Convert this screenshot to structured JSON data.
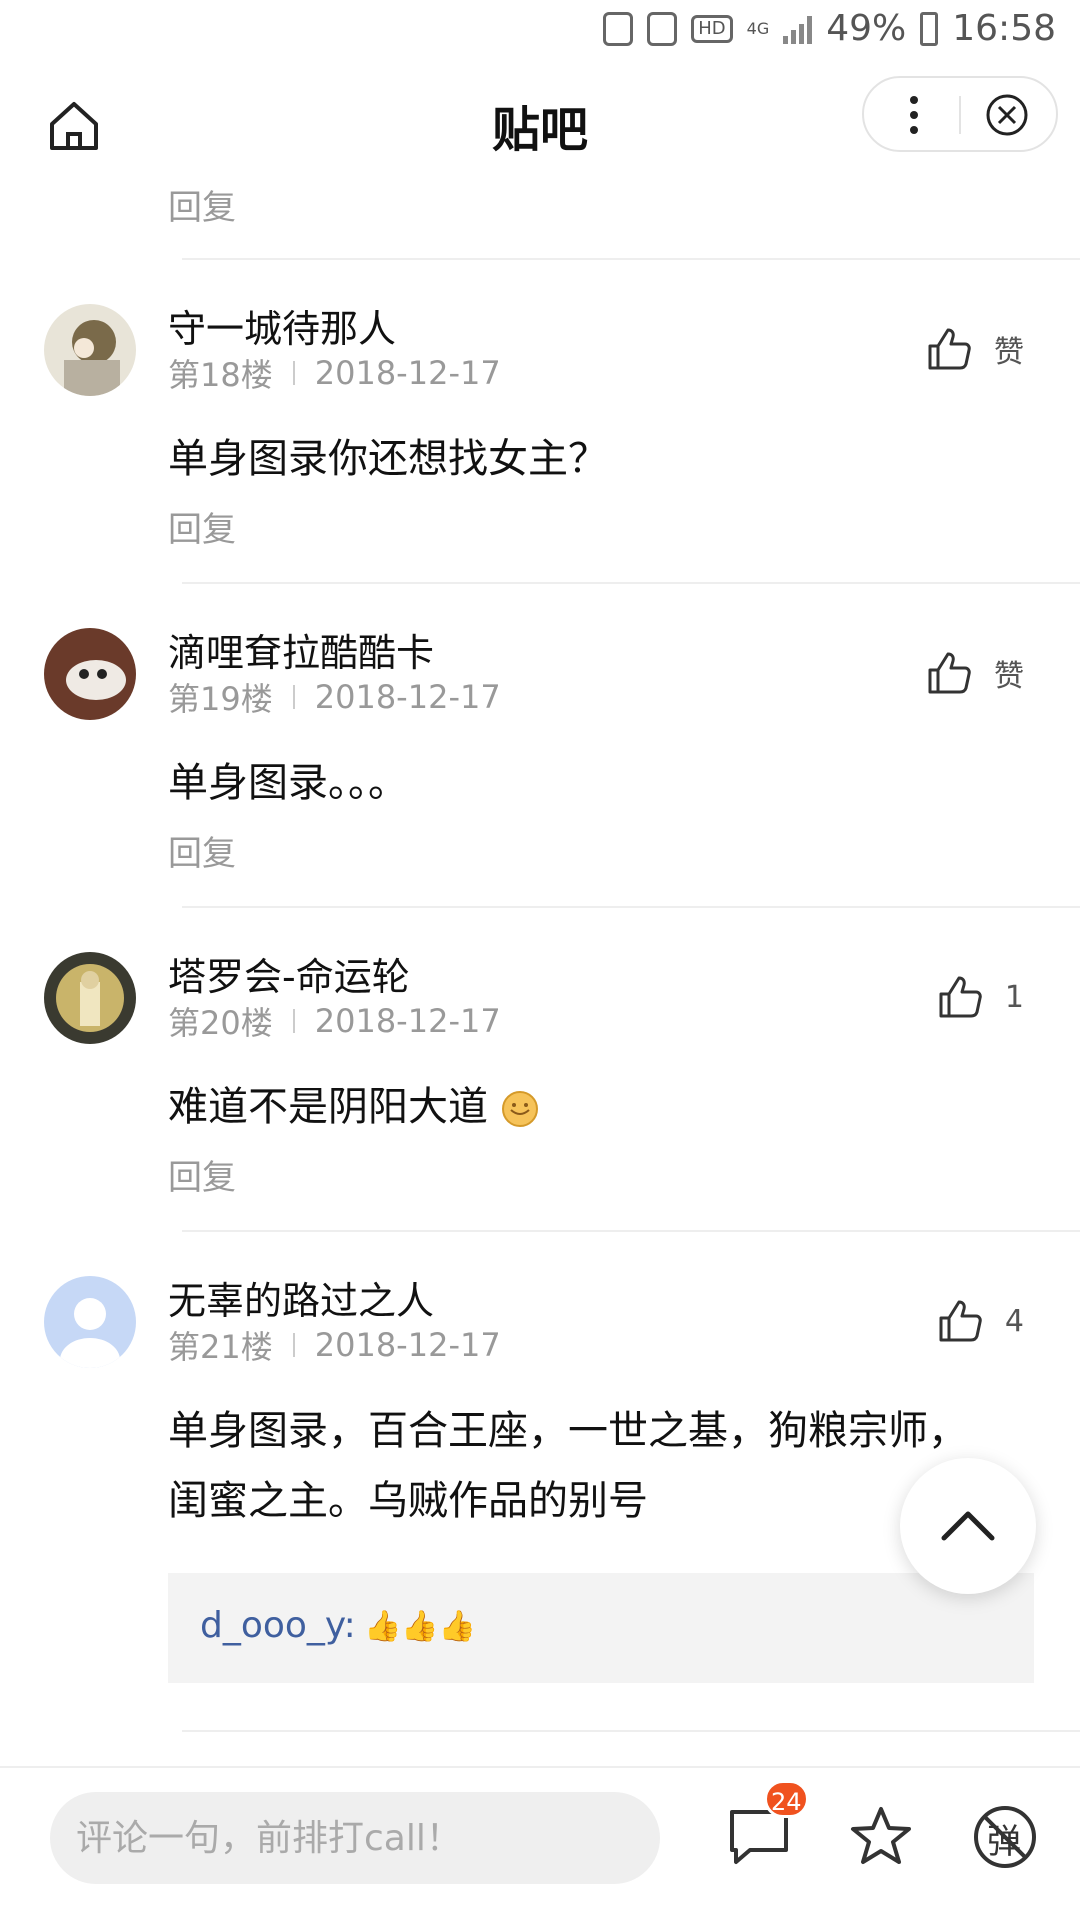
{
  "status_bar": {
    "battery_percent": "49%",
    "time": "16:58",
    "network": "4G",
    "hd": "HD"
  },
  "header": {
    "title": "贴吧"
  },
  "previous_reply_label": "回复",
  "posts": [
    {
      "username": "守一城待那人",
      "floor": "第18楼",
      "date": "2018-12-17",
      "content": "单身图录你还想找女主？",
      "like_label": "赞",
      "reply_label": "回复"
    },
    {
      "username": "滴哩耷拉酷酷卡",
      "floor": "第19楼",
      "date": "2018-12-17",
      "content": "单身图录。。。",
      "like_label": "赞",
      "reply_label": "回复"
    },
    {
      "username": "塔罗会-命运轮",
      "floor": "第20楼",
      "date": "2018-12-17",
      "content": "难道不是阴阳大道",
      "like_label": "1",
      "reply_label": "回复"
    },
    {
      "username": "无辜的路过之人",
      "floor": "第21楼",
      "date": "2018-12-17",
      "content_line1": "单身图录，百合王座，一世之基，狗粮宗师，",
      "content_line2": "闺蜜之主。乌贼作品的别号",
      "like_label": "4",
      "sub_reply": {
        "username": "d_ooo_y:",
        "thumbs": "👍👍👍"
      }
    }
  ],
  "bottom_bar": {
    "comment_placeholder": "评论一句，前排打call！",
    "comment_count": "24",
    "danmu_label": "弹"
  },
  "colors": {
    "accent_badge": "#f0521f",
    "link_name": "#3f5f9f",
    "muted": "#999999"
  }
}
